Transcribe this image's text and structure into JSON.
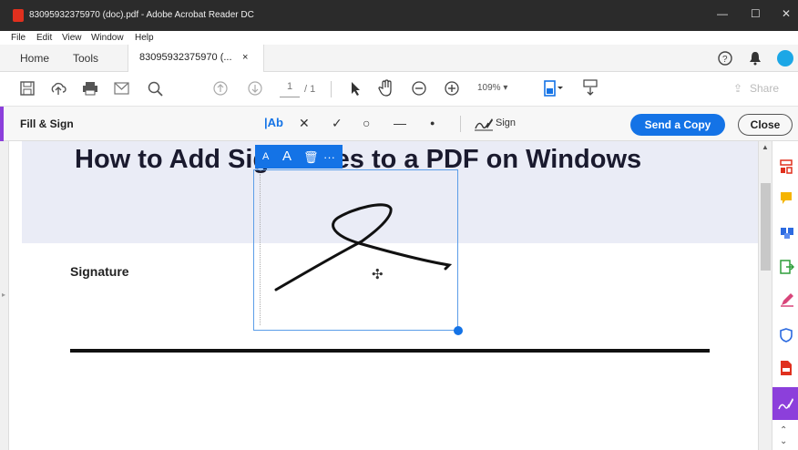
{
  "window": {
    "title": "83095932375970 (doc).pdf - Adobe Acrobat Reader DC",
    "minimize": "—",
    "maximize": "☐",
    "close": "✕"
  },
  "menu": [
    "File",
    "Edit",
    "View",
    "Window",
    "Help"
  ],
  "tabs": {
    "home": "Home",
    "tools": "Tools",
    "document": "83095932375970 (... ",
    "document_close": "×"
  },
  "toolbar": {
    "page_current": "1",
    "page_total": "/ 1",
    "zoom": "109%  ▾",
    "share": "Share"
  },
  "fillsign": {
    "title": "Fill & Sign",
    "text_tool": "|Ab",
    "cross": "✕",
    "check": "✓",
    "circle": "○",
    "line": "—",
    "dot": "●",
    "sign": "Sign",
    "send": "Send a Copy",
    "close": "Close"
  },
  "document": {
    "heading": "How to Add Signatures to a PDF on Windows",
    "signature_label": "Signature"
  },
  "sig_toolbar": {
    "smaller": "A",
    "larger": "A",
    "delete": "🗑",
    "more": "···"
  },
  "icons": {
    "save": "save-icon",
    "upload": "upload-icon",
    "print": "print-icon",
    "email": "email-icon",
    "search": "search-icon",
    "help": "help-icon",
    "bell": "bell-icon",
    "profile": "profile-icon"
  },
  "colors": {
    "accent": "#8c3fdb",
    "primary": "#1473e6"
  }
}
